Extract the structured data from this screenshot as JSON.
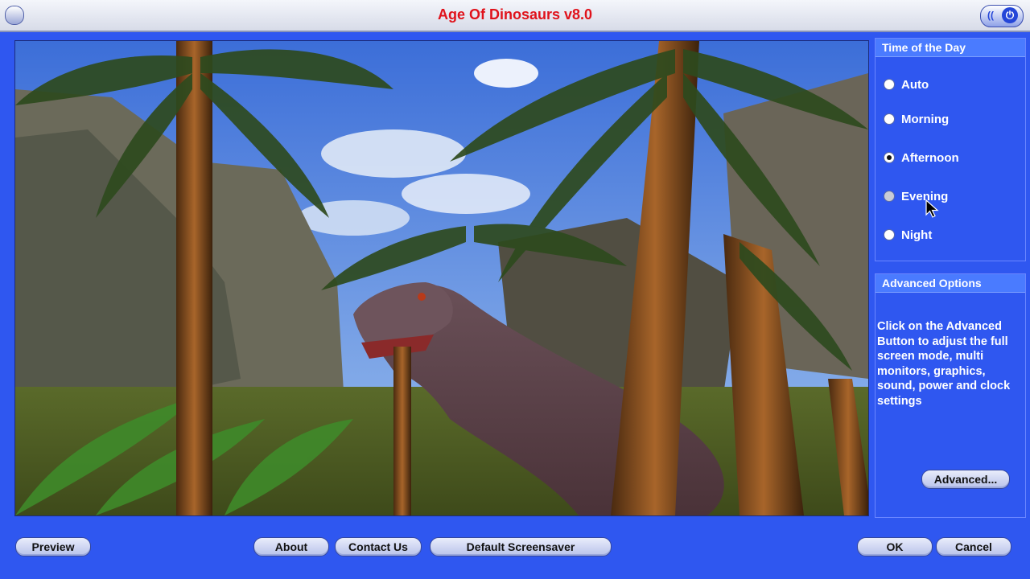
{
  "window": {
    "title": "Age Of Dinosaurs v8.0"
  },
  "time_of_day": {
    "heading": "Time of the Day",
    "options": [
      {
        "label": "Auto",
        "selected": false
      },
      {
        "label": "Morning",
        "selected": false
      },
      {
        "label": "Afternoon",
        "selected": true
      },
      {
        "label": "Evening",
        "selected": false
      },
      {
        "label": "Night",
        "selected": false
      }
    ]
  },
  "advanced": {
    "heading": "Advanced Options",
    "description": "Click on the Advanced Button to adjust the full screen mode, multi monitors, graphics, sound, power and clock settings",
    "button": "Advanced..."
  },
  "footer": {
    "preview": "Preview",
    "about": "About",
    "contact": "Contact Us",
    "default_screensaver": "Default Screensaver",
    "ok": "OK",
    "cancel": "Cancel"
  },
  "colors": {
    "window_bg": "#2f57f0",
    "title_text": "#e0121b",
    "panel_head": "#4a7bff"
  },
  "icons": {
    "titlebar_left": "system-menu-icon",
    "titlebar_right": "power-icon",
    "cursor": "mouse-pointer-icon"
  }
}
